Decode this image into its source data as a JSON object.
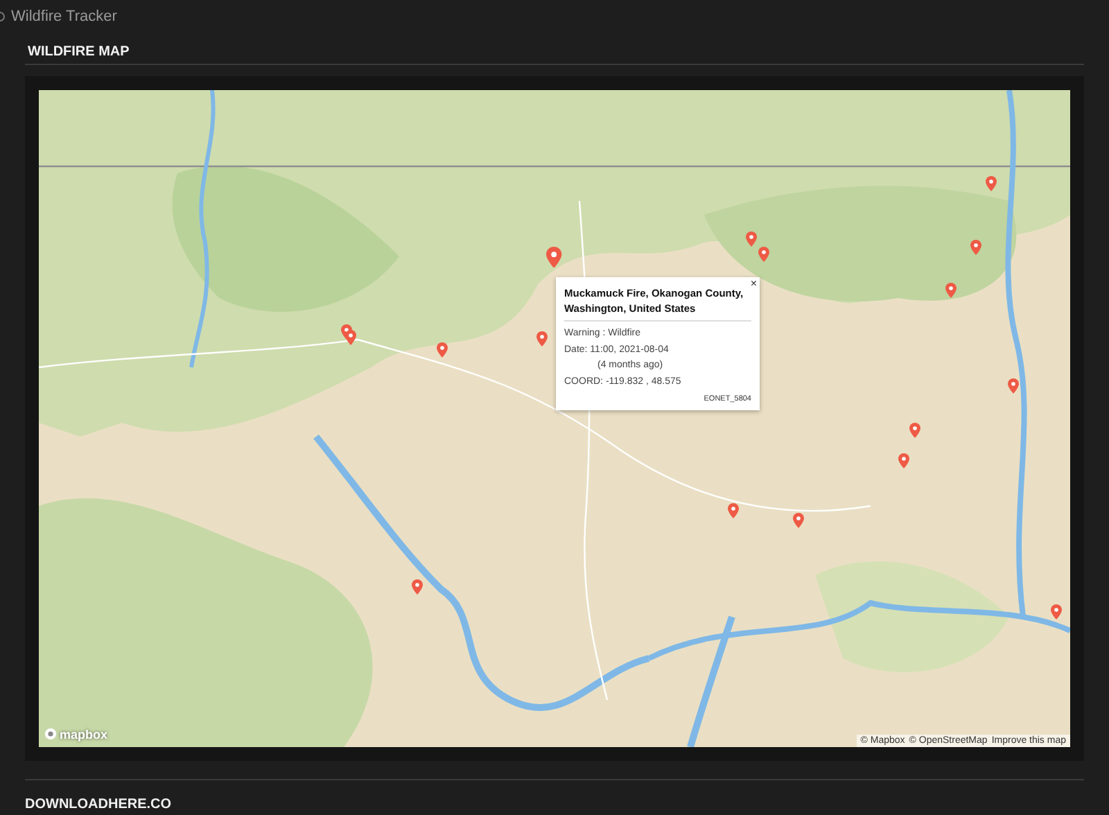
{
  "breadcrumb": {
    "label": "Wildfire Tracker"
  },
  "section": {
    "title": "WILDFIRE MAP"
  },
  "popup": {
    "title": "Muckamuck Fire, Okanogan County, Washington, United States",
    "close": "×",
    "warning": "Warning : Wildfire",
    "date": "Date: 11:00, 2021-08-04",
    "ago": "(4 months ago)",
    "coord": "COORD: -119.832 , 48.575",
    "id": "EONET_5804"
  },
  "map": {
    "logo": "mapbox",
    "attribution": [
      "© Mapbox",
      "© OpenStreetMap",
      "Improve this map"
    ]
  },
  "footer": {
    "brand": "DOWNLOADHERE.CO"
  }
}
